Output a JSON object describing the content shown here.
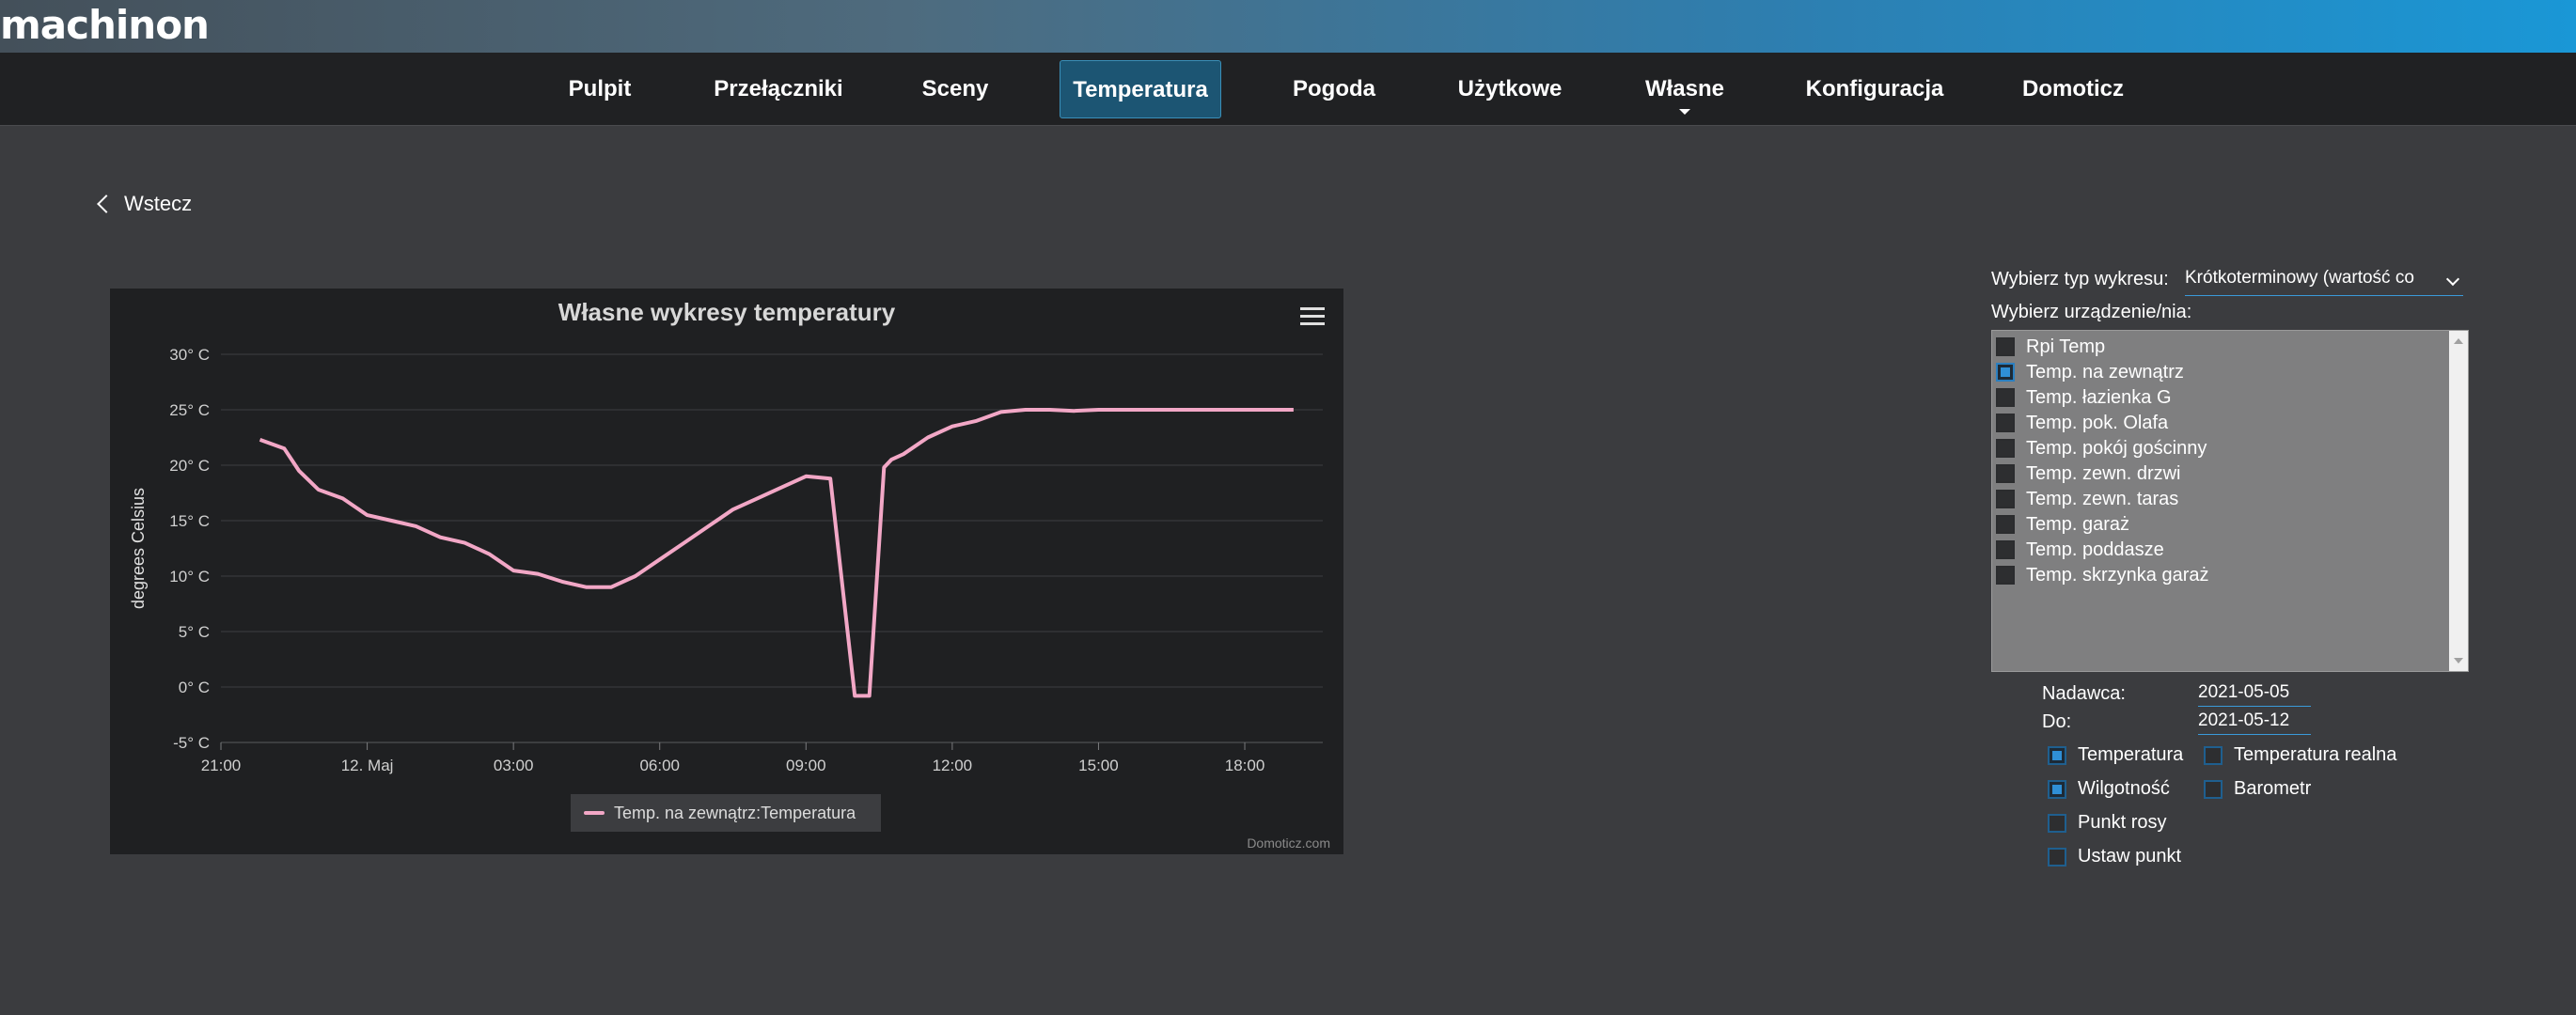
{
  "brand": {
    "logo": "machinon"
  },
  "nav": [
    {
      "label": "Pulpit",
      "active": false
    },
    {
      "label": "Przełączniki",
      "active": false
    },
    {
      "label": "Sceny",
      "active": false
    },
    {
      "label": "Temperatura",
      "active": true
    },
    {
      "label": "Pogoda",
      "active": false
    },
    {
      "label": "Użytkowe",
      "active": false
    },
    {
      "label": "Własne",
      "active": false,
      "dropdown": true
    },
    {
      "label": "Konfiguracja",
      "active": false
    },
    {
      "label": "Domoticz",
      "active": false
    }
  ],
  "back_label": "Wstecz",
  "chart": {
    "title": "Własne wykresy temperatury",
    "credits": "Domoticz.com",
    "legend_label": "Temp. na zewnątrz:Temperatura"
  },
  "chart_data": {
    "type": "line",
    "title": "Własne wykresy temperatury",
    "xlabel": "",
    "ylabel": "degrees Celsius",
    "ylim": [
      -5,
      30
    ],
    "yticks": [
      "30° C",
      "25° C",
      "20° C",
      "15° C",
      "10° C",
      "5° C",
      "0° C",
      "-5° C"
    ],
    "xticks": [
      "21:00",
      "12. Maj",
      "03:00",
      "06:00",
      "09:00",
      "12:00",
      "15:00",
      "18:00"
    ],
    "grid": true,
    "legend": "bottom-center",
    "series": [
      {
        "name": "Temp. na zewnątrz:Temperatura",
        "color": "#f2a7c6",
        "x_hours": [
          -2.2,
          -1.7,
          -1.4,
          -1.0,
          -0.5,
          0.0,
          0.5,
          1.0,
          1.5,
          2.0,
          2.5,
          3.0,
          3.5,
          4.0,
          4.5,
          5.0,
          5.5,
          6.0,
          6.5,
          7.0,
          7.5,
          8.0,
          8.5,
          9.0,
          9.5,
          10.0,
          10.2,
          10.3,
          10.6,
          10.75,
          11.0,
          11.5,
          12.0,
          12.5,
          13.0,
          13.5,
          14.0,
          14.5,
          15.0,
          15.5,
          16.0,
          17.0,
          18.0,
          19.0
        ],
        "values": [
          22.3,
          21.5,
          19.5,
          17.8,
          17.0,
          15.5,
          15.0,
          14.5,
          13.5,
          13.0,
          12.0,
          10.5,
          10.2,
          9.5,
          9.0,
          9.0,
          10.0,
          11.5,
          13.0,
          14.5,
          16.0,
          17.0,
          18.0,
          19.0,
          18.8,
          -0.8,
          -0.8,
          -0.8,
          19.8,
          20.5,
          21.0,
          22.5,
          23.5,
          24.0,
          24.8,
          25.0,
          25.0,
          24.9,
          25.0,
          25.0,
          25.0,
          25.0,
          25.0,
          25.0
        ]
      }
    ]
  },
  "controls": {
    "chart_type_label": "Wybierz typ wykresu:",
    "chart_type_value": "Krótkoterminowy (wartość co",
    "device_label": "Wybierz urządzenie/nia:",
    "devices": [
      {
        "label": "Rpi Temp",
        "checked": false
      },
      {
        "label": "Temp. na zewnątrz",
        "checked": true
      },
      {
        "label": "Temp. łazienka G",
        "checked": false
      },
      {
        "label": "Temp. pok. Olafa",
        "checked": false
      },
      {
        "label": "Temp. pokój gościnny",
        "checked": false
      },
      {
        "label": "Temp. zewn. drzwi",
        "checked": false
      },
      {
        "label": "Temp. zewn. taras",
        "checked": false
      },
      {
        "label": "Temp. garaż",
        "checked": false
      },
      {
        "label": "Temp. poddasze",
        "checked": false
      },
      {
        "label": "Temp. skrzynka garaż",
        "checked": false
      }
    ],
    "from_label": "Nadawca:",
    "from_value": "2021-05-05",
    "to_label": "Do:",
    "to_value": "2021-05-12",
    "options": [
      {
        "label": "Temperatura",
        "checked": true
      },
      {
        "label": "Temperatura realna",
        "checked": false
      },
      {
        "label": "Wilgotność",
        "checked": true
      },
      {
        "label": "Barometr",
        "checked": false
      },
      {
        "label": "Punkt rosy",
        "checked": false
      },
      {
        "label": "Ustaw punkt",
        "checked": false
      }
    ]
  }
}
